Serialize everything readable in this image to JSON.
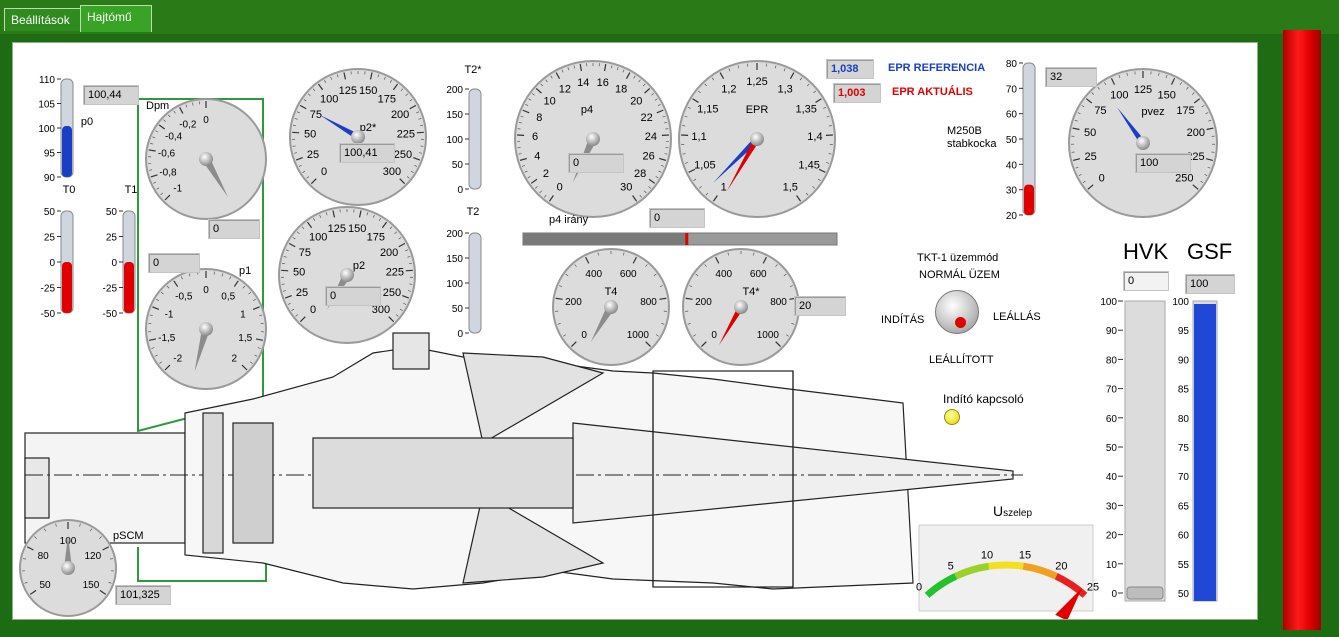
{
  "tabs": [
    {
      "label": "Beállítások"
    },
    {
      "label": "Hajtómű"
    }
  ],
  "colors": {
    "accent_red": "#e00000",
    "epr_ref": "#1a3fc4",
    "gauge_fill": "#dcdcdc"
  },
  "gauges": {
    "dpm": {
      "label": "Dpm",
      "ticks": [
        "-1",
        "-0,8",
        "-0,6",
        "-0,4",
        "-0,2",
        "0"
      ],
      "value": "0"
    },
    "p1": {
      "label": "p1",
      "ticks": [
        "-2",
        "-1,5",
        "-1",
        "-0,5",
        "0",
        "0,5",
        "1",
        "1,5",
        "2"
      ],
      "value": "0"
    },
    "p2star": {
      "label": "p2*",
      "ticks": [
        "0",
        "25",
        "50",
        "75",
        "100",
        "125",
        "150",
        "175",
        "200",
        "225",
        "250",
        "300"
      ],
      "value": "100,41"
    },
    "p2": {
      "label": "p2",
      "ticks": [
        "0",
        "25",
        "50",
        "75",
        "100",
        "125",
        "150",
        "175",
        "200",
        "225",
        "250",
        "300"
      ],
      "value": "0"
    },
    "p4": {
      "label": "p4",
      "ticks": [
        "0",
        "2",
        "4",
        "6",
        "8",
        "10",
        "12",
        "14",
        "16",
        "18",
        "20",
        "22",
        "24",
        "26",
        "28",
        "30"
      ],
      "value": "0"
    },
    "epr": {
      "label": "EPR",
      "ticks": [
        "1",
        "1,05",
        "1,1",
        "1,15",
        "1,2",
        "1,25",
        "1,3",
        "1,35",
        "1,4",
        "1,45",
        "1,5"
      ]
    },
    "pvez": {
      "label": "pvez",
      "ticks": [
        "0",
        "25",
        "50",
        "75",
        "100",
        "125",
        "150",
        "175",
        "200",
        "225",
        "250"
      ],
      "value": "100"
    },
    "t4": {
      "label": "T4",
      "ticks": [
        "0",
        "200",
        "400",
        "600",
        "800",
        "1000"
      ]
    },
    "t4star": {
      "label": "T4*",
      "ticks": [
        "0",
        "200",
        "400",
        "600",
        "800",
        "1000"
      ],
      "value": "20"
    },
    "pscm": {
      "label": "pSCM",
      "ticks": [
        "50",
        "80",
        "100",
        "120",
        "150"
      ],
      "value": "101,325"
    }
  },
  "p0": {
    "label": "p0",
    "ticks": [
      "110",
      "105",
      "100",
      "95",
      "90"
    ],
    "value": "100,44",
    "level": 0.52
  },
  "t0": {
    "label": "T0",
    "ticks": [
      "50",
      "25",
      "0",
      "-25",
      "-50"
    ],
    "level": 0.5
  },
  "t1": {
    "label": "T1",
    "ticks": [
      "50",
      "25",
      "0",
      "-25",
      "-50"
    ],
    "level": 0.5
  },
  "t1_value": "0",
  "t2star": {
    "label": "T2*",
    "ticks": [
      "200",
      "150",
      "100",
      "50",
      "0"
    ],
    "level": 0.0
  },
  "t2": {
    "label": "T2",
    "ticks": [
      "200",
      "150",
      "100",
      "50",
      "0"
    ],
    "level": 0.0
  },
  "p4_irany": {
    "label": "p4 irány",
    "value": "0",
    "slider_level": 0.52
  },
  "epr_ref": {
    "label": "EPR REFERENCIA",
    "value": "1,038"
  },
  "epr_act": {
    "label": "EPR AKTUÁLIS",
    "value": "1,003"
  },
  "m250b": {
    "label1": "M250B",
    "label2": "stabkocka",
    "ticks": [
      "80",
      "70",
      "60",
      "50",
      "40",
      "30",
      "20"
    ],
    "value": "32",
    "level": 0.2
  },
  "tkt": {
    "title": "TKT-1 üzemmód",
    "top": "NORMÁL ÜZEM",
    "left": "INDÍTÁS",
    "right": "LEÁLLÁS",
    "bottom": "LEÁLLÍTOTT"
  },
  "starter": {
    "label": "Indító kapcsoló"
  },
  "hvk": {
    "label": "HVK",
    "value": "0",
    "ticks": [
      "100",
      "90",
      "80",
      "70",
      "60",
      "50",
      "40",
      "30",
      "20",
      "10",
      "0"
    ],
    "level": 0.0
  },
  "gsf": {
    "label": "GSF",
    "value": "100",
    "ticks": [
      "100",
      "95",
      "90",
      "85",
      "80",
      "75",
      "70",
      "65",
      "60",
      "55",
      "50"
    ],
    "level": 0.99
  },
  "uszelep": {
    "label": "U",
    "sub": "szelep",
    "ticks": [
      "0",
      "5",
      "10",
      "15",
      "20",
      "25"
    ],
    "value": 24
  }
}
